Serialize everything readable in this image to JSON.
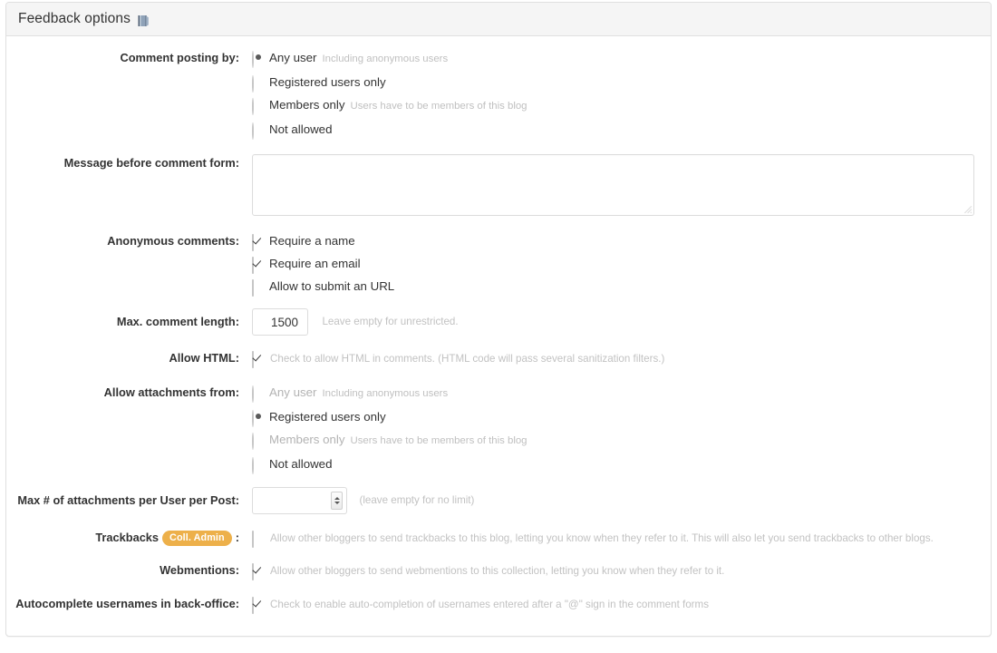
{
  "panel": {
    "title": "Feedback options",
    "title_icon": "manual-book-icon"
  },
  "colors": {
    "badge_bg": "#edb04a",
    "badge_text": "#ffffff",
    "header_bg": "#f5f5f5",
    "border": "#e0e0e0",
    "label_text": "#333333",
    "hint_text": "#c2c2c2"
  },
  "rows": {
    "comment_posting": {
      "label": "Comment posting by:",
      "options": [
        {
          "label": "Any user",
          "hint": "Including anonymous users",
          "checked": true,
          "muted": false
        },
        {
          "label": "Registered users only",
          "hint": "",
          "checked": false,
          "muted": false
        },
        {
          "label": "Members only",
          "hint": "Users have to be members of this blog",
          "checked": false,
          "muted": false
        },
        {
          "label": "Not allowed",
          "hint": "",
          "checked": false,
          "muted": false
        }
      ]
    },
    "message_before_form": {
      "label": "Message before comment form:",
      "value": "",
      "placeholder": ""
    },
    "anonymous_comments": {
      "label": "Anonymous comments:",
      "options": [
        {
          "label": "Require a name",
          "checked": true
        },
        {
          "label": "Require an email",
          "checked": true
        },
        {
          "label": "Allow to submit an URL",
          "checked": false
        }
      ]
    },
    "max_comment_length": {
      "label": "Max. comment length:",
      "value": "1500",
      "hint": "Leave empty for unrestricted."
    },
    "allow_html": {
      "label": "Allow HTML:",
      "checked": true,
      "description": "Check to allow HTML in comments. (HTML code will pass several sanitization filters.)"
    },
    "allow_attachments_from": {
      "label": "Allow attachments from:",
      "options": [
        {
          "label": "Any user",
          "hint": "Including anonymous users",
          "checked": false,
          "muted": true
        },
        {
          "label": "Registered users only",
          "hint": "",
          "checked": true,
          "muted": false
        },
        {
          "label": "Members only",
          "hint": "Users have to be members of this blog",
          "checked": false,
          "muted": true
        },
        {
          "label": "Not allowed",
          "hint": "",
          "checked": false,
          "muted": false
        }
      ]
    },
    "max_attachments": {
      "label": "Max # of attachments per User per Post:",
      "value": "",
      "hint": "(leave empty for no limit)"
    },
    "trackbacks": {
      "label": "Trackbacks",
      "badge": "Coll. Admin",
      "colon": ":",
      "checked": false,
      "description": "Allow other bloggers to send trackbacks to this blog, letting you know when they refer to it. This will also let you send trackbacks to other blogs."
    },
    "webmentions": {
      "label": "Webmentions:",
      "checked": true,
      "description": "Allow other bloggers to send webmentions to this collection, letting you know when they refer to it."
    },
    "autocomplete_usernames": {
      "label": "Autocomplete usernames in back-office:",
      "checked": true,
      "description": "Check to enable auto-completion of usernames entered after a \"@\" sign in the comment forms"
    }
  }
}
